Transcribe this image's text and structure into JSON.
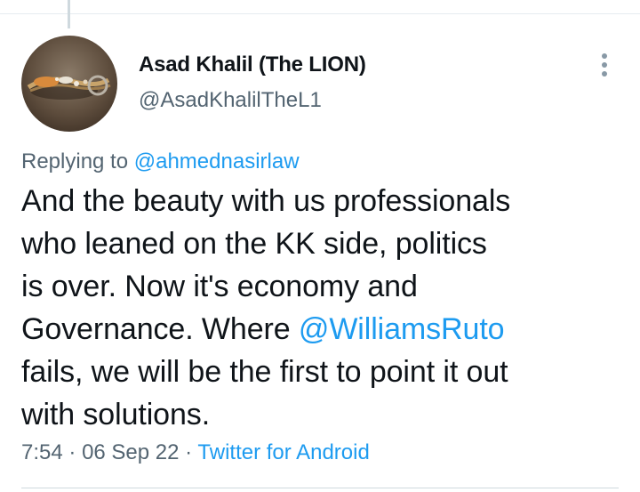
{
  "tweet": {
    "author": {
      "display_name": "Asad Khalil (The LION)",
      "handle": "@AsadKhalilTheL1"
    },
    "replying_to_label": "Replying to",
    "replying_to_handle": "@ahmednasirlaw",
    "text_lines": [
      {
        "text": "And the beauty with us professionals"
      },
      {
        "text": "who leaned on the KK side, politics"
      },
      {
        "text": "is over. Now it's economy and"
      },
      {
        "before": "Governance. Where ",
        "mention": "@WilliamsRuto"
      },
      {
        "text": "fails, we will be the first to point it out"
      },
      {
        "text": "with solutions."
      }
    ],
    "time": "7:54",
    "date": "06 Sep 22",
    "separator": "·",
    "source": "Twitter for Android"
  },
  "icons": {
    "more": "more-vertical-icon",
    "avatar": "avatar-image"
  },
  "colors": {
    "link": "#1d9bf0",
    "secondary_text": "#536471",
    "primary_text": "#0f1419",
    "divider": "#cfd9de",
    "more_dots": "#8899a6"
  }
}
